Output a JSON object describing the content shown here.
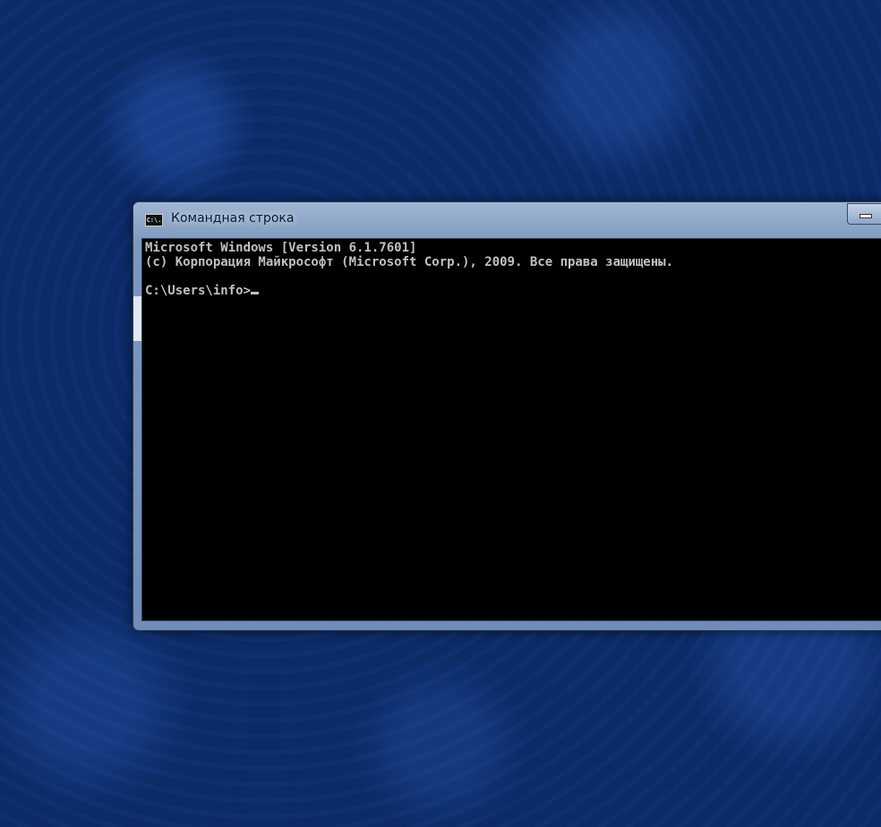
{
  "window": {
    "title": "Командная строка",
    "icon": "cmd-icon",
    "icon_text": "C:\\."
  },
  "console": {
    "lines": [
      "Microsoft Windows [Version 6.1.7601]",
      "(c) Корпорация Майкрософт (Microsoft Corp.), 2009. Все права защищены.",
      ""
    ],
    "prompt": "C:\\Users\\info>"
  }
}
